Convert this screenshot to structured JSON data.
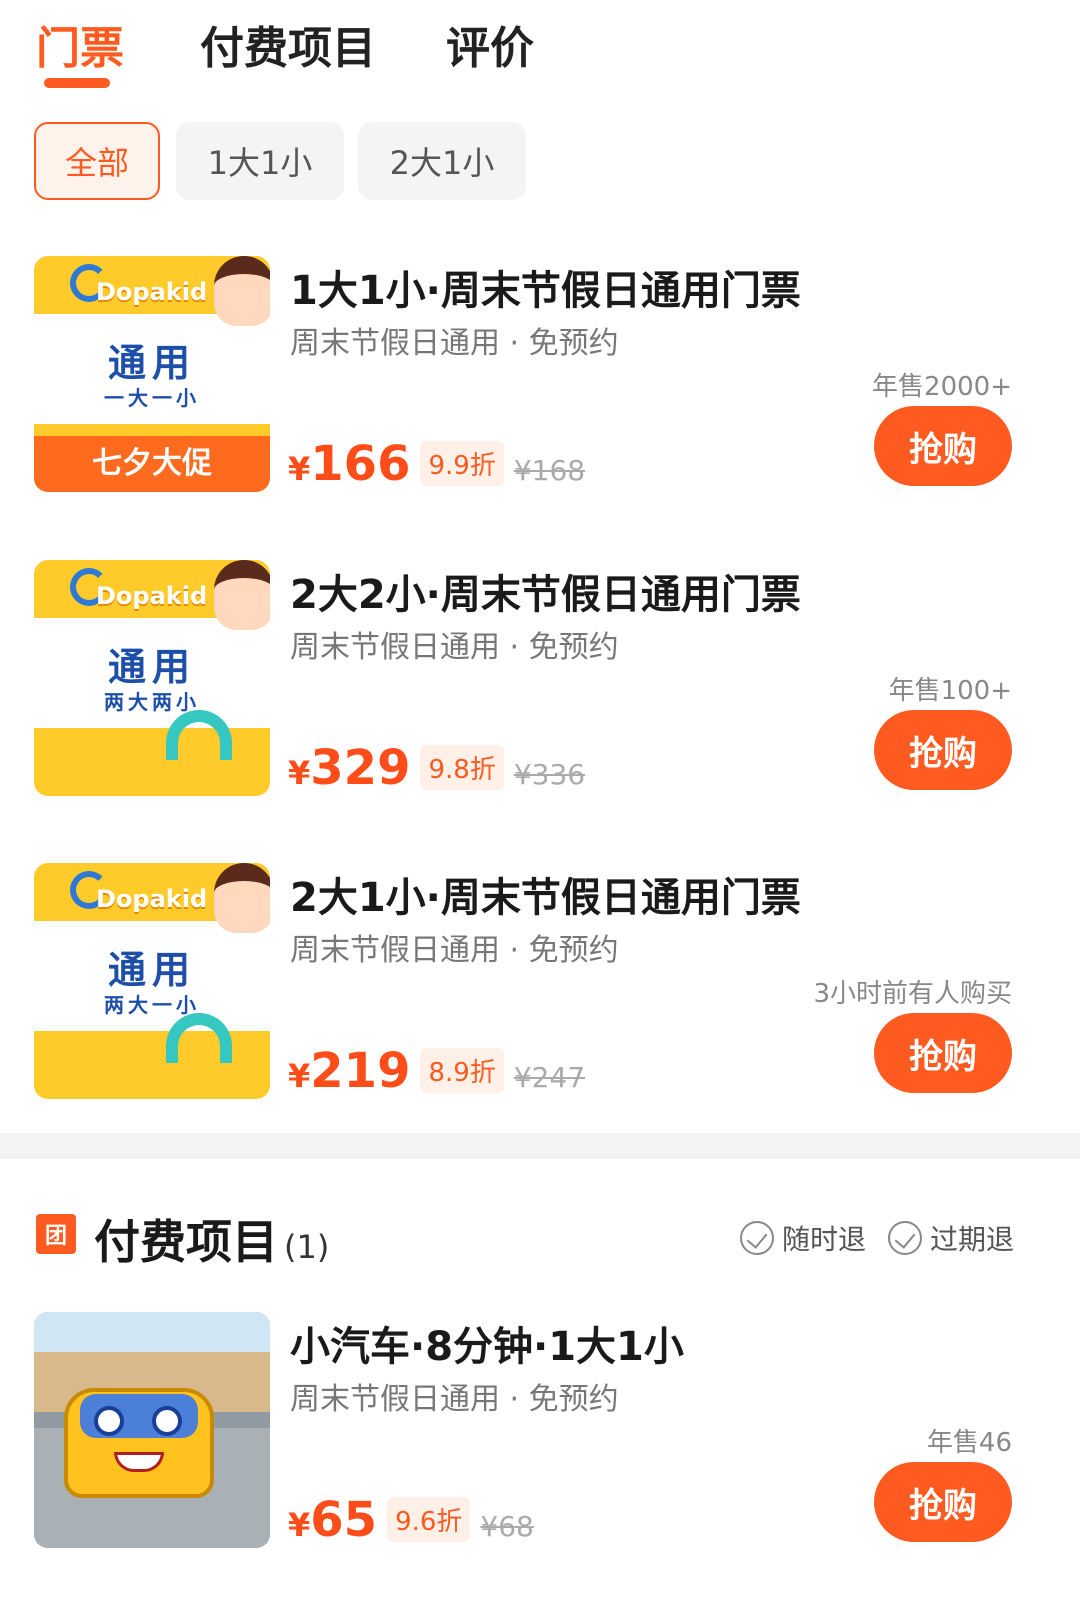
{
  "tabs": [
    {
      "label": "门票",
      "active": true
    },
    {
      "label": "付费项目",
      "active": false
    },
    {
      "label": "评价",
      "active": false
    }
  ],
  "filters": [
    {
      "label": "全部",
      "active": true
    },
    {
      "label": "1大1小",
      "active": false
    },
    {
      "label": "2大1小",
      "active": false
    }
  ],
  "tickets": [
    {
      "title": "1大1小·周末节假日通用门票",
      "subtitle": "周末节假日通用 · 免预约",
      "sales": "年售2000+",
      "currency": "¥",
      "price": "166",
      "discount": "9.9折",
      "original_price": "¥168",
      "buy_label": "抢购",
      "thumb": {
        "brand": "Dopakid",
        "big": "通用",
        "small": "一大一小",
        "promo": "七夕大促"
      }
    },
    {
      "title": "2大2小·周末节假日通用门票",
      "subtitle": "周末节假日通用 · 免预约",
      "sales": "年售100+",
      "currency": "¥",
      "price": "329",
      "discount": "9.8折",
      "original_price": "¥336",
      "buy_label": "抢购",
      "thumb": {
        "brand": "Dopakid",
        "big": "通用",
        "small": "两大两小",
        "promo": ""
      }
    },
    {
      "title": "2大1小·周末节假日通用门票",
      "subtitle": "周末节假日通用 · 免预约",
      "sales": "3小时前有人购买",
      "currency": "¥",
      "price": "219",
      "discount": "8.9折",
      "original_price": "¥247",
      "buy_label": "抢购",
      "thumb": {
        "brand": "Dopakid",
        "big": "通用",
        "small": "两大一小",
        "promo": ""
      }
    }
  ],
  "paid_section": {
    "icon": "团",
    "title": "付费项目",
    "count": "(1)",
    "policies": [
      "随时退",
      "过期退"
    ]
  },
  "paid_items": [
    {
      "title": "小汽车·8分钟·1大1小",
      "subtitle": "周末节假日通用 · 免预约",
      "sales": "年售46",
      "currency": "¥",
      "price": "65",
      "discount": "9.6折",
      "original_price": "¥68",
      "buy_label": "抢购"
    }
  ],
  "colors": {
    "accent": "#ff5a1f",
    "price": "#ff4d1a",
    "divider": "#f3f3f3"
  }
}
